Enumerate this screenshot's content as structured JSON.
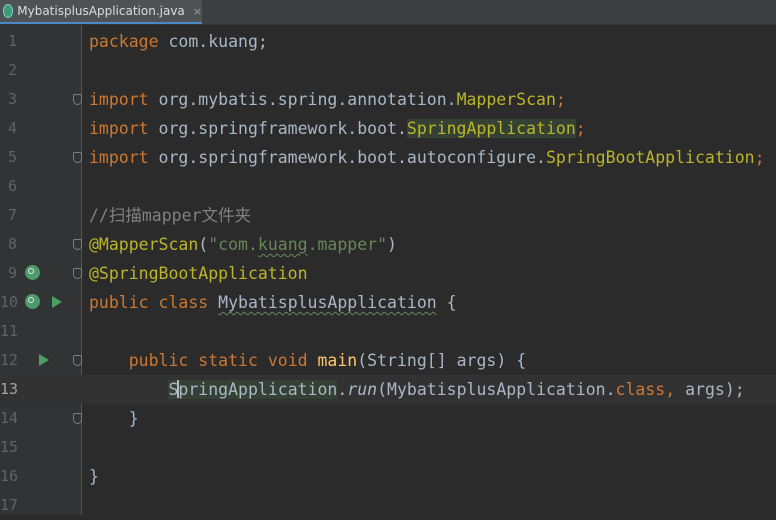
{
  "tab": {
    "filename": "MybatisplusApplication.java",
    "close_glyph": "×",
    "file_icon": "spring-class-icon"
  },
  "editor": {
    "current_line": 13,
    "line_numbers": [
      "1",
      "2",
      "3",
      "4",
      "5",
      "6",
      "7",
      "8",
      "9",
      "10",
      "11",
      "12",
      "13",
      "14",
      "15",
      "16",
      "17"
    ],
    "lines": {
      "l1": {
        "kw": "package",
        "rest": " com.kuang;"
      },
      "l3": {
        "kw": "import",
        "pkg": " org.mybatis.spring.annotation.",
        "cls": "MapperScan",
        "semi": ";"
      },
      "l4": {
        "kw": "import",
        "pkg": " org.springframework.boot.",
        "cls": "SpringApplication",
        "semi": ";"
      },
      "l5": {
        "kw": "import",
        "pkg": " org.springframework.boot.autoconfigure.",
        "cls": "SpringBootApplication",
        "semi": ";"
      },
      "l7": {
        "comment": "//扫描mapper文件夹"
      },
      "l8": {
        "ann": "@MapperScan",
        "open": "(",
        "q1": "\"com.",
        "sq": "kuang",
        "q2": ".mapper\"",
        "close": ")"
      },
      "l9": {
        "ann": "@SpringBootApplication"
      },
      "l10": {
        "kw1": "public",
        "kw2": " class",
        "sp": " ",
        "name": "MybatisplusApplication",
        "brace": " {"
      },
      "l12": {
        "indent": "    ",
        "kw": "public static void",
        "sp": " ",
        "fn": "main",
        "params": "(String[] args) {"
      },
      "l13": {
        "indent": "        ",
        "s1": "S",
        "s2": "pringApplication",
        "dot": ".",
        "call": "run",
        "open": "(MybatisplusApplication.",
        "kw": "class",
        "comma": ",",
        "rest": " args);"
      },
      "l14": {
        "indent": "    ",
        "brace": "}"
      },
      "l16": {
        "brace": "}"
      }
    }
  },
  "gutter_icons": {
    "l9": "spring-bean-icon",
    "l10": [
      "spring-bean-icon",
      "run-icon"
    ],
    "l12": "run-icon"
  },
  "colors": {
    "background": "#2b2b2b",
    "gutter": "#313335",
    "keyword": "#cc7832",
    "annotation": "#bbb529",
    "string": "#6a8759",
    "comment": "#808080",
    "function": "#ffc66d",
    "text": "#a9b7c6",
    "tab_underline": "#4a88c7"
  }
}
